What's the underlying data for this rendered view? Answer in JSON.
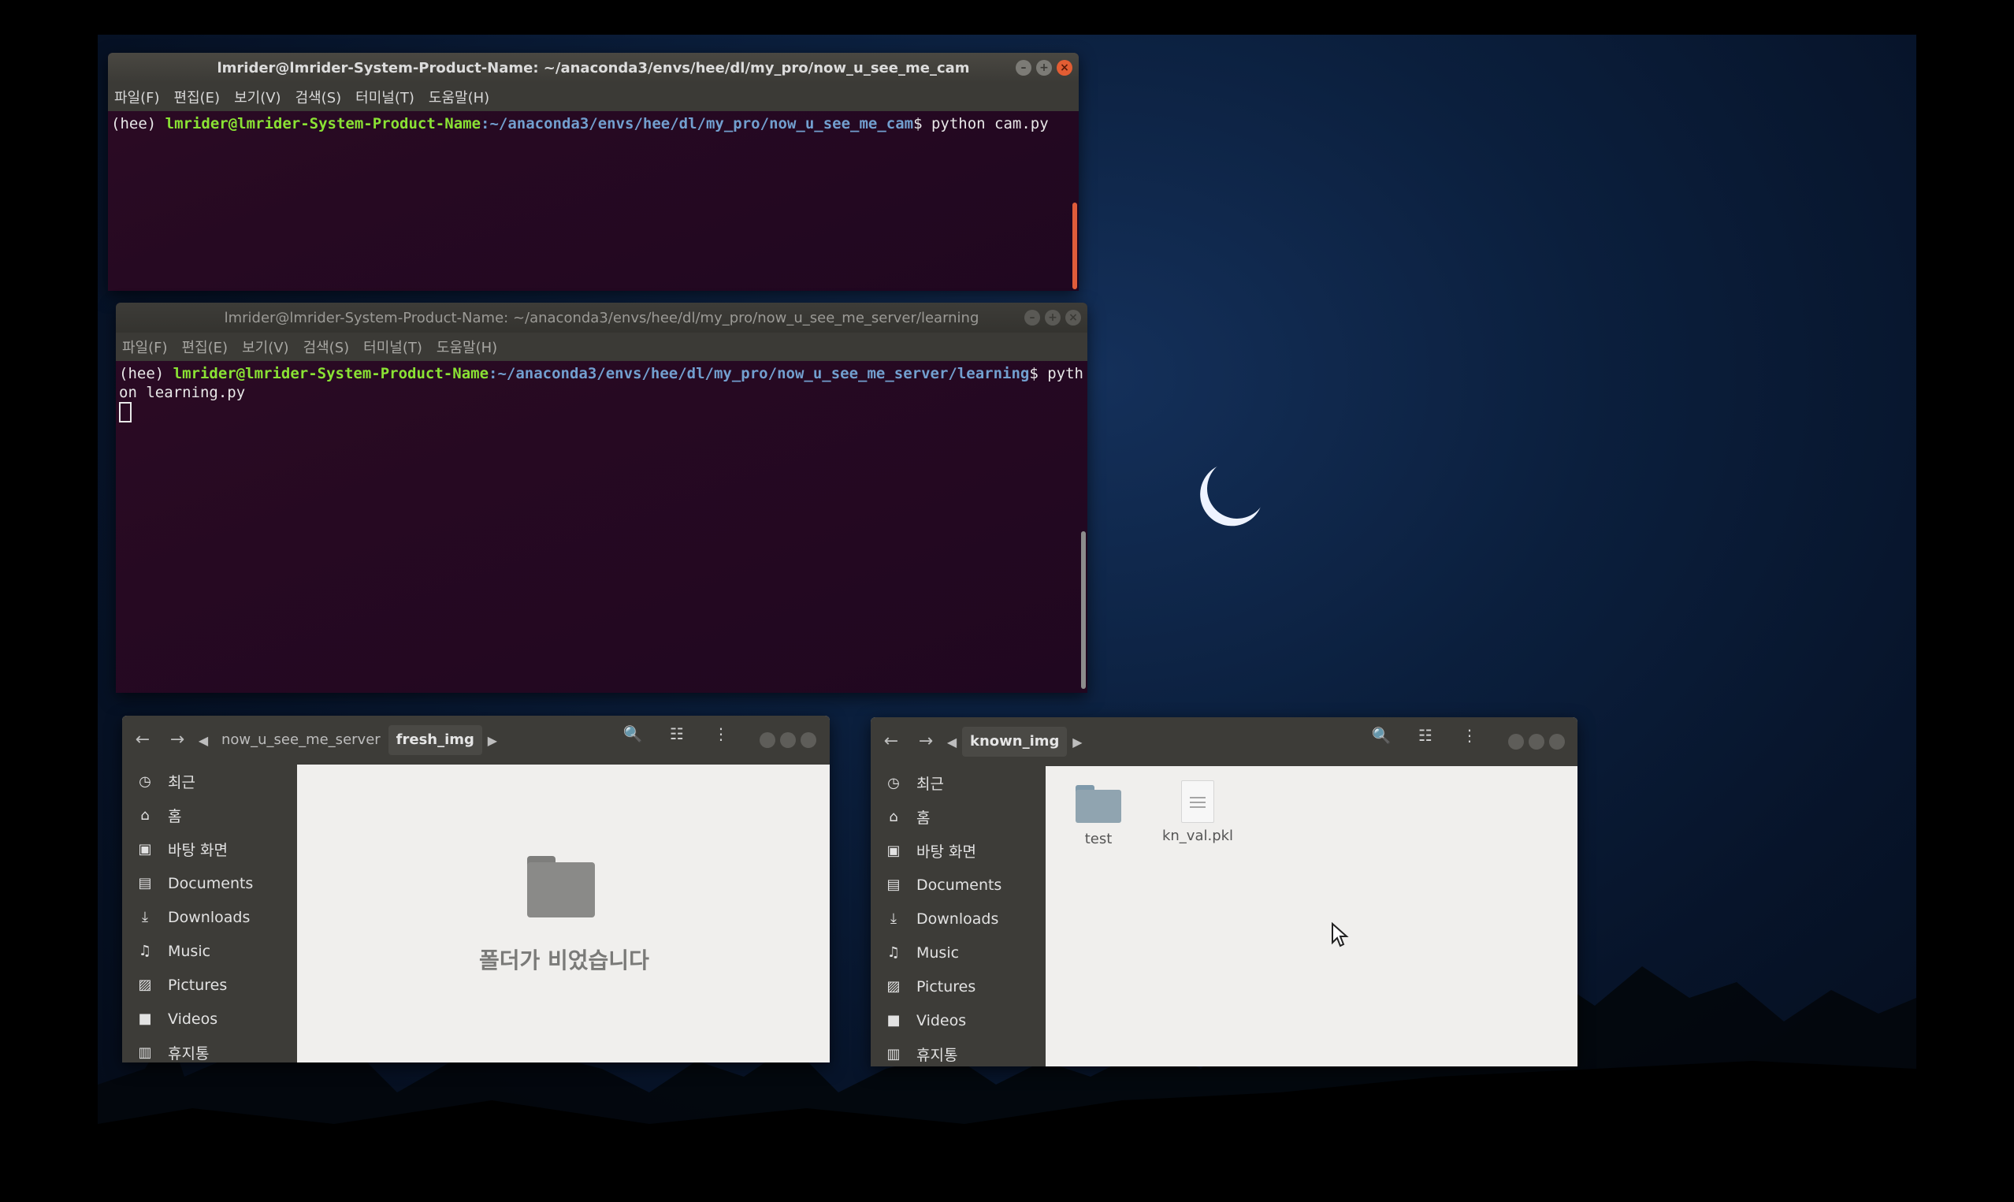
{
  "terminal1": {
    "title": "lmrider@lmrider-System-Product-Name: ~/anaconda3/envs/hee/dl/my_pro/now_u_see_me_cam",
    "menu": [
      "파일(F)",
      "편집(E)",
      "보기(V)",
      "검색(S)",
      "터미널(T)",
      "도움말(H)"
    ],
    "env": "(hee) ",
    "user": "lmrider@lmrider-System-Product-Name",
    "path": ":~/anaconda3/envs/hee/dl/my_pro/now_u_see_me_cam",
    "command": "$ python cam.py"
  },
  "terminal2": {
    "title": "lmrider@lmrider-System-Product-Name: ~/anaconda3/envs/hee/dl/my_pro/now_u_see_me_server/learning",
    "menu": [
      "파일(F)",
      "편집(E)",
      "보기(V)",
      "검색(S)",
      "터미널(T)",
      "도움말(H)"
    ],
    "env": "(hee) ",
    "user": "lmrider@lmrider-System-Product-Name",
    "path": ":~/anaconda3/envs/hee/dl/my_pro/now_u_see_me_server/learning",
    "command": "$ python learning.py"
  },
  "filemanager1": {
    "breadcrumbs": [
      "now_u_see_me_server",
      "fresh_img"
    ],
    "sidebar": [
      "최근",
      "홈",
      "바탕 화면",
      "Documents",
      "Downloads",
      "Music",
      "Pictures",
      "Videos",
      "휴지통"
    ],
    "empty_message": "폴더가 비었습니다"
  },
  "filemanager2": {
    "breadcrumbs": [
      "known_img"
    ],
    "sidebar": [
      "최근",
      "홈",
      "바탕 화면",
      "Documents",
      "Downloads",
      "Music",
      "Pictures",
      "Videos",
      "휴지통"
    ],
    "files": [
      {
        "name": "test",
        "icon": "folder-icon"
      },
      {
        "name": "kn_val.pkl",
        "icon": "document-icon"
      }
    ]
  },
  "colors": {
    "terminal_bg": "#260922",
    "prompt_user": "#8ae234",
    "prompt_path": "#729fcf",
    "close_button": "#e35d33",
    "sidebar_bg": "#3d3c38"
  }
}
